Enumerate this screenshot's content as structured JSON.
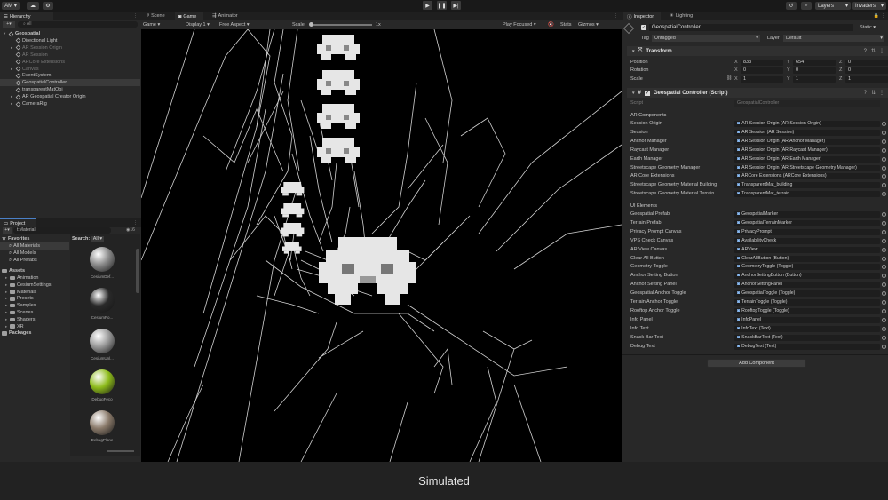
{
  "toolbar": {
    "account": "AM",
    "layers": "Layers",
    "layout": "Invaders"
  },
  "hierarchy": {
    "tab": "Hierarchy",
    "search_placeholder": "All",
    "items": [
      {
        "label": "Geospatial",
        "indent": 0,
        "dim": false,
        "sel": false,
        "expand": true,
        "root": true
      },
      {
        "label": "Directional Light",
        "indent": 1,
        "dim": false,
        "sel": false,
        "expand": false,
        "root": false
      },
      {
        "label": "AR Session Origin",
        "indent": 1,
        "dim": true,
        "sel": false,
        "expand": true,
        "root": false
      },
      {
        "label": "AR Session",
        "indent": 1,
        "dim": true,
        "sel": false,
        "expand": false,
        "root": false
      },
      {
        "label": "ARCore Extensions",
        "indent": 1,
        "dim": true,
        "sel": false,
        "expand": false,
        "root": false
      },
      {
        "label": "Canvas",
        "indent": 1,
        "dim": true,
        "sel": false,
        "expand": true,
        "root": false
      },
      {
        "label": "EventSystem",
        "indent": 1,
        "dim": false,
        "sel": false,
        "expand": false,
        "root": false
      },
      {
        "label": "GeospatialController",
        "indent": 1,
        "dim": false,
        "sel": true,
        "expand": false,
        "root": false
      },
      {
        "label": "transparentMatObj",
        "indent": 1,
        "dim": false,
        "sel": false,
        "expand": false,
        "root": false
      },
      {
        "label": "AR Geospatial Creator Origin",
        "indent": 1,
        "dim": false,
        "sel": false,
        "expand": true,
        "root": false
      },
      {
        "label": "CameraRig",
        "indent": 1,
        "dim": false,
        "sel": false,
        "expand": true,
        "root": false
      }
    ]
  },
  "project": {
    "tab": "Project",
    "search_value": "t:Material",
    "count": "16",
    "favorites_label": "Favorites",
    "favorites": [
      "All Materials",
      "All Models",
      "All Prefabs"
    ],
    "assets_label": "Assets",
    "folders": [
      "Animation",
      "CesiumSettings",
      "Materials",
      "Presets",
      "Samples",
      "Scenes",
      "Shaders",
      "XR"
    ],
    "packages_label": "Packages",
    "search_label": "Search:",
    "search_scope": "All",
    "assets": [
      {
        "name": "CesiumDef...",
        "color": "#8a8a8a"
      },
      {
        "name": "CesiumPo...",
        "color": "#2a2a2a"
      },
      {
        "name": "CesiumUnl...",
        "color": "#9a9a9a"
      },
      {
        "name": "DebugFeco",
        "color": "#8dbb1a"
      },
      {
        "name": "DebugPlane",
        "color": "#8a7a6a"
      }
    ]
  },
  "views": {
    "tabs": [
      "Scene",
      "Game",
      "Animator"
    ],
    "display_mode": "Game",
    "display": "Display 1",
    "aspect": "Free Aspect",
    "scale_label": "Scale",
    "scale_value": "1x",
    "play_focus": "Play Focused",
    "stats": "Stats",
    "gizmos": "Gizmos"
  },
  "inspector": {
    "tabs": [
      "Inspector",
      "Lighting"
    ],
    "object_name": "GeospatialController",
    "static_label": "Static",
    "tag_label": "Tag",
    "tag_value": "Untagged",
    "layer_label": "Layer",
    "layer_value": "Default",
    "transform": {
      "title": "Transform",
      "position_label": "Position",
      "rotation_label": "Rotation",
      "scale_label": "Scale",
      "position": [
        "833",
        "654",
        "0"
      ],
      "rotation": [
        "0",
        "0",
        "0"
      ],
      "scale": [
        "1",
        "1",
        "1"
      ],
      "axes": [
        "X",
        "Y",
        "Z"
      ]
    },
    "component": {
      "title": "Geospatial Controller (Script)",
      "script_label": "Script",
      "script_value": "GeospatialController",
      "ar_section": "AR Components",
      "ar_rows": [
        {
          "label": "Session Origin",
          "value": "AR Session Origin (AR Session Origin)"
        },
        {
          "label": "Session",
          "value": "AR Session (AR Session)"
        },
        {
          "label": "Anchor Manager",
          "value": "AR Session Origin (AR Anchor Manager)"
        },
        {
          "label": "Raycast Manager",
          "value": "AR Session Origin (AR Raycast Manager)"
        },
        {
          "label": "Earth Manager",
          "value": "AR Session Origin (AR Earth Manager)"
        },
        {
          "label": "Streetscape Geometry Manager",
          "value": "AR Session Origin (AR Streetscape Geometry Manager)"
        },
        {
          "label": "AR Core Extensions",
          "value": "ARCore Extensions (ARCore Extensions)"
        },
        {
          "label": "Streetscape Geometry Material Building",
          "value": "TransparentMat_building"
        },
        {
          "label": "Streetscape Geometry Material Terrain",
          "value": "TransparentMat_terrain"
        }
      ],
      "ui_section": "UI Elements",
      "ui_rows": [
        {
          "label": "Geospatial Prefab",
          "value": "GeospatialMarker"
        },
        {
          "label": "Terrain Prefab",
          "value": "GeospatialTerrainMarker"
        },
        {
          "label": "Privacy Prompt Canvas",
          "value": "PrivacyPrompt"
        },
        {
          "label": "VPS Check Canvas",
          "value": "AvailabilityCheck"
        },
        {
          "label": "AR View Canvas",
          "value": "ARView"
        },
        {
          "label": "Clear All Button",
          "value": "ClearAllButton (Button)"
        },
        {
          "label": "Geometry Toggle",
          "value": "GeometryToggle (Toggle)"
        },
        {
          "label": "Anchor Setting Button",
          "value": "AnchorSettingButton (Button)"
        },
        {
          "label": "Anchor Setting Panel",
          "value": "AnchorSettingPanel"
        },
        {
          "label": "Geospatial Anchor Toggle",
          "value": "GeospatialToggle (Toggle)"
        },
        {
          "label": "Terrain Anchor Toggle",
          "value": "TerrainToggle (Toggle)"
        },
        {
          "label": "Rooftop Anchor Toggle",
          "value": "RooftopToggle (Toggle)"
        },
        {
          "label": "Info Panel",
          "value": "InfoPanel"
        },
        {
          "label": "Info Text",
          "value": "InfoText (Text)"
        },
        {
          "label": "Snack Bar Text",
          "value": "SnackBarText (Text)"
        },
        {
          "label": "Debug Text",
          "value": "DebugText (Text)"
        }
      ]
    },
    "add_component": "Add Component"
  },
  "caption": "Simulated"
}
